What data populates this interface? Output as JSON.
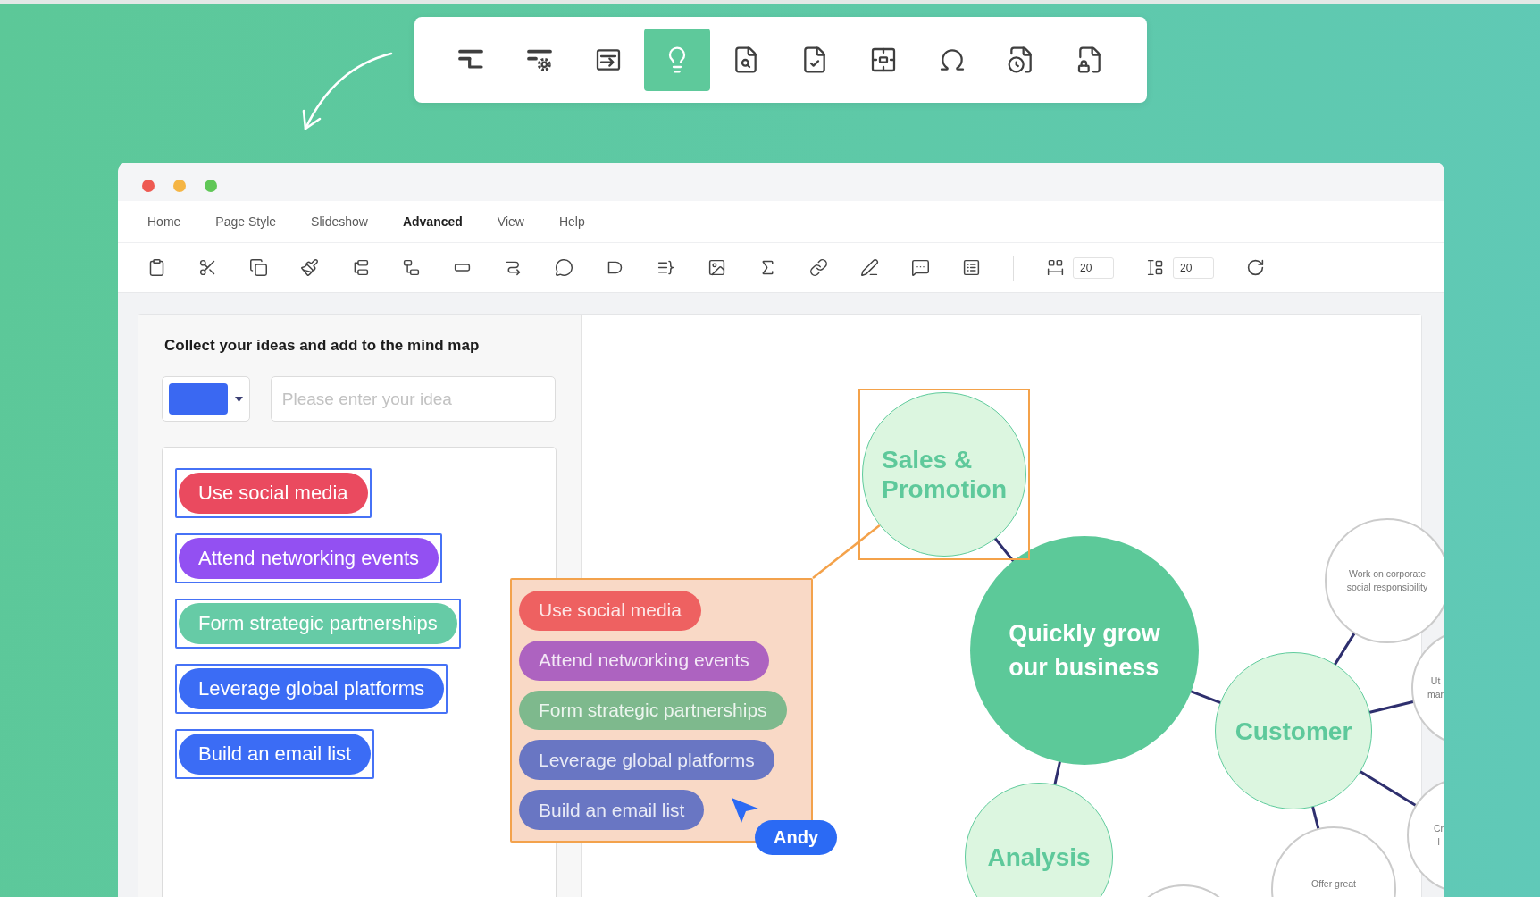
{
  "feature_toolbar": {
    "buttons": [
      {
        "selected": false
      },
      {
        "selected": false
      },
      {
        "selected": false
      },
      {
        "selected": true
      },
      {
        "selected": false
      },
      {
        "selected": false
      },
      {
        "selected": false
      },
      {
        "selected": false
      },
      {
        "selected": false
      },
      {
        "selected": false
      }
    ]
  },
  "menu": [
    {
      "label": "Home",
      "selected": false
    },
    {
      "label": "Page Style",
      "selected": false
    },
    {
      "label": "Slideshow",
      "selected": false
    },
    {
      "label": "Advanced",
      "selected": true
    },
    {
      "label": "View",
      "selected": false
    },
    {
      "label": "Help",
      "selected": false
    }
  ],
  "toolbar": {
    "spacing_fields": [
      {
        "value": "20"
      },
      {
        "value": "20"
      }
    ]
  },
  "idea_panel": {
    "title": "Collect your ideas and add to the mind map",
    "color_picker": {
      "color": "#3a68f2"
    },
    "idea_input": {
      "placeholder": "Please enter your idea"
    },
    "ideas": [
      {
        "text": "Use social media",
        "color": "#ea4a5f",
        "selected": true
      },
      {
        "text": "Attend networking events",
        "color": "#9350f2",
        "selected": true
      },
      {
        "text": "Form strategic partnerships",
        "color": "#66cba6",
        "selected": true
      },
      {
        "text": "Leverage global platforms",
        "color": "#3b6cf5",
        "selected": true
      },
      {
        "text": "Build an email list",
        "color": "#3b6cf5",
        "selected": true
      }
    ]
  },
  "idea_popover": {
    "ideas": [
      {
        "text": "Use social media",
        "color": "#ee6161"
      },
      {
        "text": "Attend networking events",
        "color": "#ad63c0"
      },
      {
        "text": "Form strategic partnerships",
        "color": "#7eb98d"
      },
      {
        "text": "Leverage global platforms",
        "color": "#6976c3"
      },
      {
        "text": "Build an email list",
        "color": "#6976c3"
      }
    ]
  },
  "collaborator_cursor": {
    "name": "Andy"
  },
  "mind_map": {
    "central": {
      "lines": [
        "Quickly grow",
        "our business"
      ],
      "selected": false,
      "children": [
        {
          "lines": [
            "Sales &",
            "Promotion"
          ],
          "selected": true
        },
        {
          "lines": [
            "Customer"
          ],
          "selected": false,
          "children": [
            {
              "lines": [
                "Work on corporate",
                "social responsibility"
              ],
              "selected": false
            },
            {
              "lines": [
                "Ut",
                "mar"
              ],
              "selected": false
            },
            {
              "lines": [
                "Cr",
                "l"
              ],
              "selected": false
            },
            {
              "lines": [
                "Offer great"
              ],
              "selected": false
            }
          ]
        },
        {
          "lines": [
            "Analysis"
          ],
          "selected": false
        }
      ]
    }
  }
}
